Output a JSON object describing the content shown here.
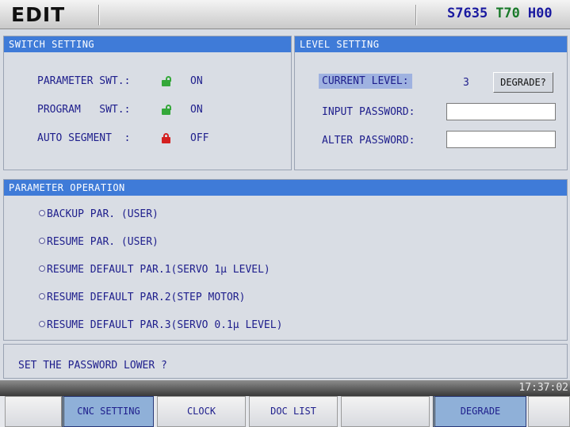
{
  "topbar": {
    "mode": "EDIT",
    "spindle": "S7635",
    "tool": "T70",
    "h_offset": "H00"
  },
  "switch_setting": {
    "header": "SWITCH SETTING",
    "rows": [
      {
        "label": "PARAMETER SWT.:",
        "state": "ON",
        "lock": "open"
      },
      {
        "label": "PROGRAM   SWT.:",
        "state": "ON",
        "lock": "open"
      },
      {
        "label": "AUTO SEGMENT  :",
        "state": "OFF",
        "lock": "closed"
      }
    ]
  },
  "level_setting": {
    "header": "LEVEL SETTING",
    "current_level_label": "CURRENT LEVEL:",
    "current_level_value": "3",
    "degrade_button": "DEGRADE?",
    "input_password_label": "INPUT PASSWORD:",
    "input_password_value": "",
    "alter_password_label": "ALTER PASSWORD:",
    "alter_password_value": ""
  },
  "parameter_operation": {
    "header": "PARAMETER OPERATION",
    "options": [
      "BACKUP PAR. (USER)",
      "RESUME PAR. (USER)",
      "RESUME DEFAULT PAR.1(SERVO 1μ LEVEL)",
      "RESUME DEFAULT PAR.2(STEP MOTOR)",
      "RESUME DEFAULT PAR.3(SERVO 0.1μ LEVEL)"
    ]
  },
  "message": "SET THE PASSWORD LOWER ?",
  "time": "17:37:02",
  "softkeys": {
    "k1": "",
    "k2": "CNC SETTING",
    "k3": "CLOCK",
    "k4": "DOC LIST",
    "k5": "",
    "k6": "DEGRADE",
    "k7": ""
  },
  "colors": {
    "header_bg": "#3f7bd8",
    "text": "#1e1e8c",
    "lock_open": "#35a83a",
    "lock_closed": "#d42020",
    "active_key": "#8fb0d8"
  }
}
